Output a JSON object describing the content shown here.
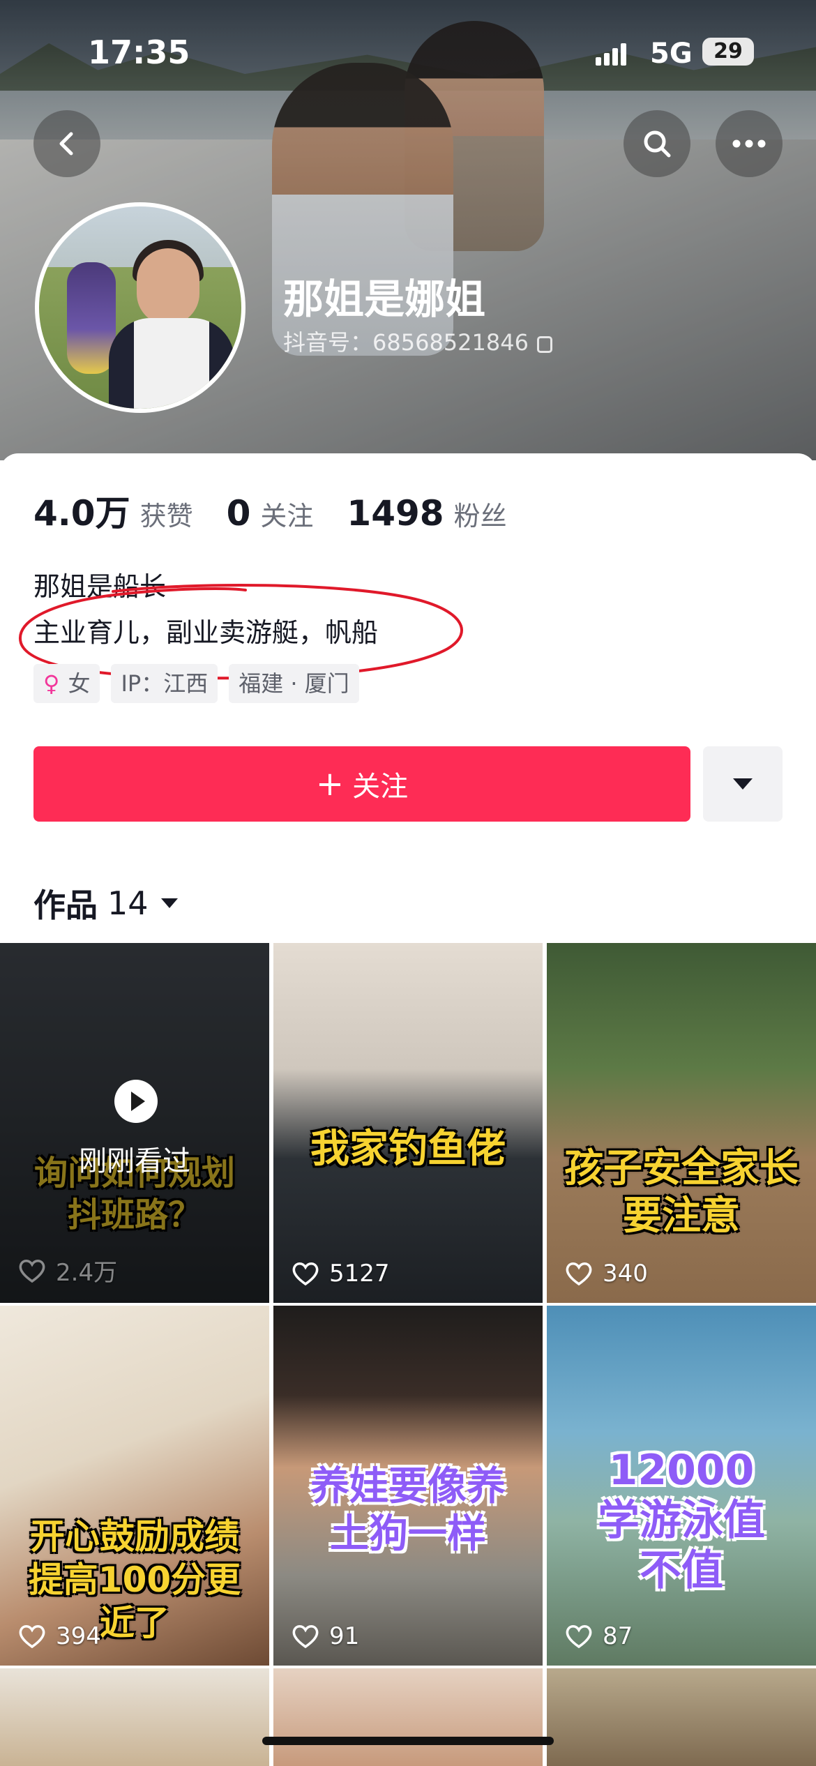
{
  "status_bar": {
    "time": "17:35",
    "network": "5G",
    "battery": "29"
  },
  "profile": {
    "name": "那姐是娜姐",
    "douyin_id": "抖音号：68568521846",
    "stats": [
      {
        "value": "4.0万",
        "label": "获赞"
      },
      {
        "value": "0",
        "label": "关注"
      },
      {
        "value": "1498",
        "label": "粉丝"
      }
    ],
    "bio_line1": "那姐是船长",
    "bio_line2": "主业育儿，副业卖游艇，帆船",
    "tags": {
      "gender_icon": "female-icon",
      "gender": "女",
      "ip": "IP：江西",
      "location": "福建 · 厦门"
    }
  },
  "actions": {
    "follow_label": "关注"
  },
  "works": {
    "label": "作品",
    "count": "14"
  },
  "videos": [
    {
      "caption": "询问如何规划抖班路？",
      "likes": "2.4万",
      "overlay": "刚刚看过"
    },
    {
      "caption": "我家钓鱼佬",
      "likes": "5127"
    },
    {
      "caption": "孩子安全家长要注意",
      "likes": "340"
    },
    {
      "caption": "开心鼓励成绩提高100分更近了",
      "likes": "394"
    },
    {
      "caption": "养娃要像养土狗一样",
      "likes": "91"
    },
    {
      "caption": "12000学游泳值不值",
      "likes": "87"
    }
  ],
  "colors": {
    "accent": "#fe2c55",
    "annotation": "#e0192a",
    "caption_yellow": "#f7d331",
    "caption_purple": "#8e5cf7"
  }
}
